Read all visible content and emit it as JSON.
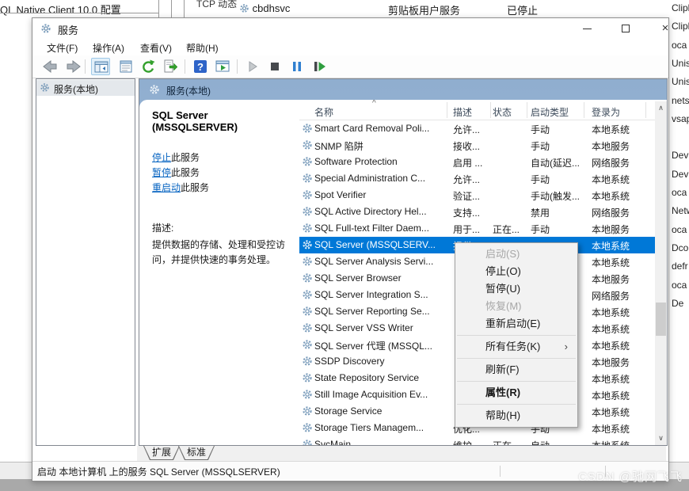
{
  "colors": {
    "accent": "#0078d7",
    "band": "#90aecf",
    "link": "#0563c1"
  },
  "background": {
    "top_left_title": "QL Native Client 10.0 配置",
    "top_row": {
      "tcp": "TCP 动态",
      "service_name": "cbdhsvc",
      "display_name": "剪贴板用户服务",
      "status": "已停止"
    },
    "right_fragments": [
      "Clipl",
      "Clipl",
      "oca",
      "Unis",
      "Unis",
      "nets",
      "vsap",
      "",
      "Devi",
      "Devi",
      "oca",
      "Netw",
      "oca",
      "Dco",
      "defr",
      "oca",
      "De"
    ],
    "watermark": "CSDN @驰网飞飞"
  },
  "window": {
    "title": "服务",
    "menu_items": [
      "文件(F)",
      "操作(A)",
      "查看(V)",
      "帮助(H)"
    ],
    "toolbar_icons": [
      "back",
      "forward",
      "sep",
      "show-console-tree",
      "properties",
      "refresh",
      "export-list",
      "sep",
      "help",
      "show-action-pane",
      "sep",
      "start-service",
      "stop-service",
      "pause-service",
      "restart-service"
    ],
    "tabs": [
      "扩展",
      "标准"
    ],
    "statusbar": "启动 本地计算机 上的服务 SQL Server (MSSQLSERVER)"
  },
  "tree": {
    "root_label": "服务(本地)"
  },
  "pane": {
    "header": "服务(本地)",
    "service_title": "SQL Server (MSSQLSERVER)",
    "actions": [
      {
        "link": "停止",
        "suffix": "此服务"
      },
      {
        "link": "暂停",
        "suffix": "此服务"
      },
      {
        "link": "重启动",
        "suffix": "此服务"
      }
    ],
    "description_label": "描述:",
    "description": "提供数据的存储、处理和受控访问，并提供快速的事务处理。"
  },
  "list": {
    "columns": [
      "名称",
      "描述",
      "状态",
      "启动类型",
      "登录为"
    ],
    "rows": [
      {
        "name": "Smart Card Removal Poli...",
        "desc": "允许...",
        "status": "",
        "startup": "手动",
        "logon": "本地系统",
        "selected": false
      },
      {
        "name": "SNMP 陷阱",
        "desc": "接收...",
        "status": "",
        "startup": "手动",
        "logon": "本地服务",
        "selected": false
      },
      {
        "name": "Software Protection",
        "desc": "启用 ...",
        "status": "",
        "startup": "自动(延迟...",
        "logon": "网络服务",
        "selected": false
      },
      {
        "name": "Special Administration C...",
        "desc": "允许...",
        "status": "",
        "startup": "手动",
        "logon": "本地系统",
        "selected": false
      },
      {
        "name": "Spot Verifier",
        "desc": "验证...",
        "status": "",
        "startup": "手动(触发...",
        "logon": "本地系统",
        "selected": false
      },
      {
        "name": "SQL Active Directory Hel...",
        "desc": "支持...",
        "status": "",
        "startup": "禁用",
        "logon": "网络服务",
        "selected": false
      },
      {
        "name": "SQL Full-text Filter Daem...",
        "desc": "用于...",
        "status": "正在...",
        "startup": "手动",
        "logon": "本地服务",
        "selected": false
      },
      {
        "name": "SQL Server (MSSQLSERV...",
        "desc": "提供...",
        "status": "",
        "startup": "",
        "logon": "本地系统",
        "selected": true
      },
      {
        "name": "SQL Server Analysis Servi...",
        "desc": "",
        "status": "",
        "startup": "",
        "logon": "本地系统",
        "selected": false
      },
      {
        "name": "SQL Server Browser",
        "desc": "",
        "status": "",
        "startup": "",
        "logon": "本地服务",
        "selected": false
      },
      {
        "name": "SQL Server Integration S...",
        "desc": "",
        "status": "",
        "startup": "",
        "logon": "网络服务",
        "selected": false
      },
      {
        "name": "SQL Server Reporting Se...",
        "desc": "",
        "status": "",
        "startup": "",
        "logon": "本地系统",
        "selected": false
      },
      {
        "name": "SQL Server VSS Writer",
        "desc": "",
        "status": "",
        "startup": "",
        "logon": "本地系统",
        "selected": false
      },
      {
        "name": "SQL Server 代理 (MSSQL...",
        "desc": "",
        "status": "",
        "startup": "",
        "logon": "本地系统",
        "selected": false
      },
      {
        "name": "SSDP Discovery",
        "desc": "",
        "status": "",
        "startup": "",
        "logon": "本地服务",
        "selected": false
      },
      {
        "name": "State Repository Service",
        "desc": "",
        "status": "",
        "startup": "",
        "logon": "本地系统",
        "selected": false
      },
      {
        "name": "Still Image Acquisition Ev...",
        "desc": "",
        "status": "",
        "startup": "",
        "logon": "本地系统",
        "selected": false
      },
      {
        "name": "Storage Service",
        "desc": "",
        "status": "",
        "startup": "",
        "logon": "本地系统",
        "selected": false
      },
      {
        "name": "Storage Tiers Managem...",
        "desc": "优化...",
        "status": "",
        "startup": "手动",
        "logon": "本地系统",
        "selected": false
      },
      {
        "name": "SvcMain",
        "desc": "维护",
        "status": "正在",
        "startup": "自动",
        "logon": "本地系统",
        "selected": false
      }
    ]
  },
  "context_menu": {
    "items": [
      {
        "label": "启动(S)",
        "disabled": true,
        "bold": false,
        "submenu": false,
        "sep": false
      },
      {
        "label": "停止(O)",
        "disabled": false,
        "bold": false,
        "submenu": false,
        "sep": false
      },
      {
        "label": "暂停(U)",
        "disabled": false,
        "bold": false,
        "submenu": false,
        "sep": false
      },
      {
        "label": "恢复(M)",
        "disabled": true,
        "bold": false,
        "submenu": false,
        "sep": false
      },
      {
        "label": "重新启动(E)",
        "disabled": false,
        "bold": false,
        "submenu": false,
        "sep": false
      },
      {
        "label": "",
        "sep": true
      },
      {
        "label": "所有任务(K)",
        "disabled": false,
        "bold": false,
        "submenu": true,
        "sep": false
      },
      {
        "label": "",
        "sep": true
      },
      {
        "label": "刷新(F)",
        "disabled": false,
        "bold": false,
        "submenu": false,
        "sep": false
      },
      {
        "label": "",
        "sep": true
      },
      {
        "label": "属性(R)",
        "disabled": false,
        "bold": true,
        "submenu": false,
        "sep": false
      },
      {
        "label": "",
        "sep": true
      },
      {
        "label": "帮助(H)",
        "disabled": false,
        "bold": false,
        "submenu": false,
        "sep": false
      }
    ]
  }
}
